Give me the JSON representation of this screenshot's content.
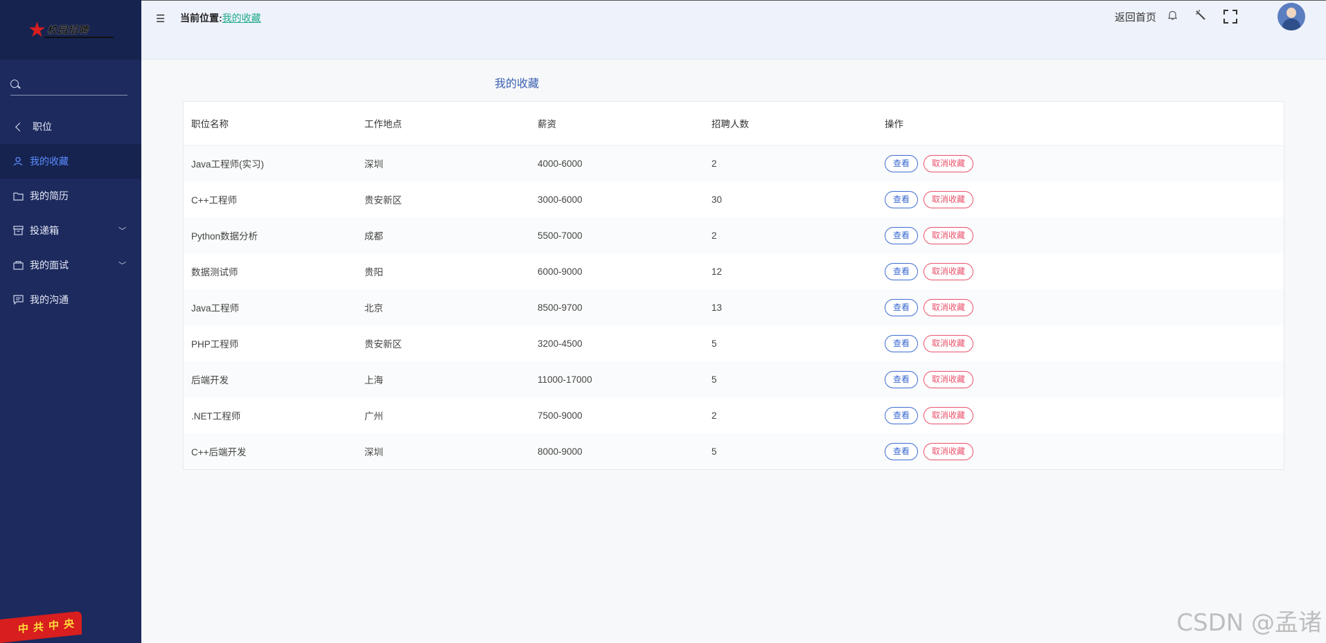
{
  "sidebar": {
    "logo_text": "校园招聘",
    "search_placeholder": "",
    "back_label": "职位",
    "items": [
      {
        "label": "我的收藏",
        "icon": "user-icon",
        "active": true
      },
      {
        "label": "我的简历",
        "icon": "folder-icon"
      },
      {
        "label": "投递箱",
        "icon": "inbox-icon",
        "has_children": true
      },
      {
        "label": "我的面试",
        "icon": "briefcase-icon",
        "has_children": true
      },
      {
        "label": "我的沟通",
        "icon": "chat-icon"
      }
    ],
    "flag_chars": [
      "中",
      "共",
      "中",
      "央"
    ]
  },
  "header": {
    "breadcrumb_prefix": "当前位置:",
    "breadcrumb_current": "我的收藏",
    "home_link": "返回首页"
  },
  "main": {
    "title": "我的收藏",
    "columns": [
      "职位名称",
      "工作地点",
      "薪资",
      "招聘人数",
      "操作"
    ],
    "view_label": "查看",
    "cancel_label": "取消收藏",
    "rows": [
      {
        "name": "Java工程师(实习)",
        "location": "深圳",
        "salary": "4000-6000",
        "count": "2"
      },
      {
        "name": "C++工程师",
        "location": "贵安新区",
        "salary": "3000-6000",
        "count": "30"
      },
      {
        "name": "Python数据分析",
        "location": "成都",
        "salary": "5500-7000",
        "count": "2"
      },
      {
        "name": "数据测试师",
        "location": "贵阳",
        "salary": "6000-9000",
        "count": "12"
      },
      {
        "name": "Java工程师",
        "location": "北京",
        "salary": "8500-9700",
        "count": "13"
      },
      {
        "name": "PHP工程师",
        "location": "贵安新区",
        "salary": "3200-4500",
        "count": "5"
      },
      {
        "name": "后端开发",
        "location": "上海",
        "salary": "11000-17000",
        "count": "5"
      },
      {
        "name": ".NET工程师",
        "location": "广州",
        "salary": "7500-9000",
        "count": "2"
      },
      {
        "name": "C++后端开发",
        "location": "深圳",
        "salary": "8000-9000",
        "count": "5"
      }
    ]
  },
  "watermark": "CSDN @孟诸",
  "colors": {
    "sidebar_bg": "#1c2a5e",
    "accent": "#3b6bd0",
    "danger": "#e9506a",
    "link": "#1faa8b"
  }
}
